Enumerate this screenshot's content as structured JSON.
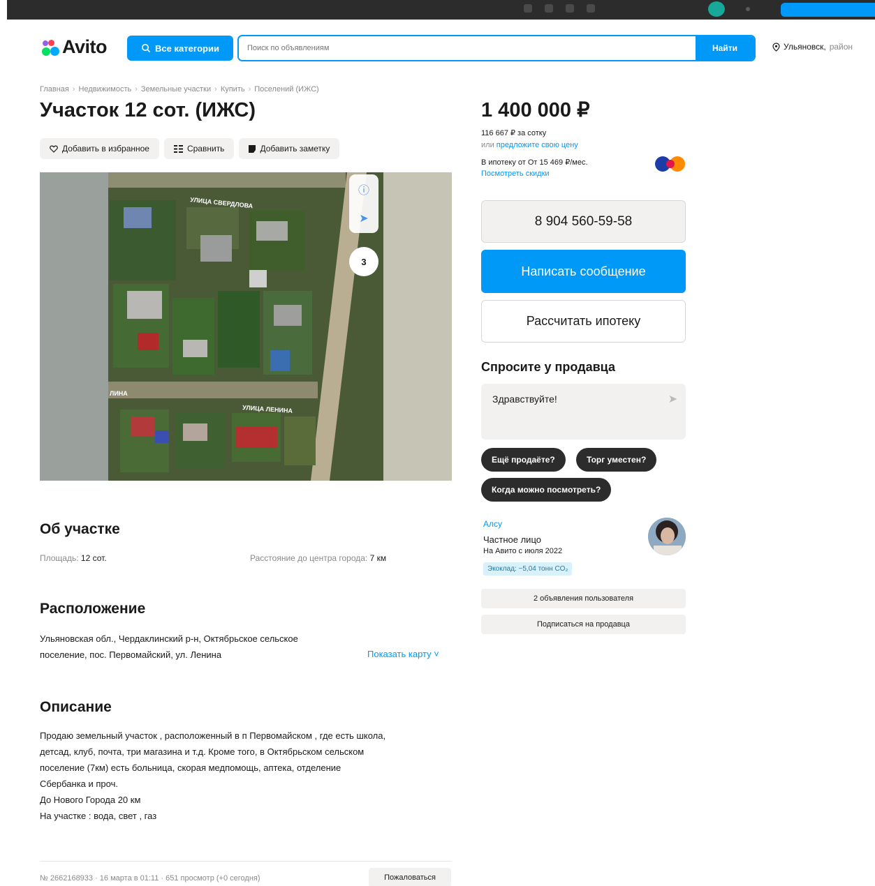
{
  "header": {
    "logo": "Avito",
    "categories_button": "Все категории",
    "search_placeholder": "Поиск по объявлениям",
    "search_button": "Найти",
    "location_city": "Ульяновск,",
    "location_region": "район"
  },
  "breadcrumb": [
    "Главная",
    "Недвижимость",
    "Земельные участки",
    "Купить",
    "Поселений (ИЖС)"
  ],
  "listing": {
    "title": "Участок 12 сот. (ИЖС)",
    "actions": {
      "favorite": "Добавить в избранное",
      "compare": "Сравнить",
      "note": "Добавить заметку"
    },
    "photo": {
      "street_top": "УЛИЦА СВЕРДЛОВА",
      "street_bottom": "УЛИЦА ЛЕНИНА",
      "street_left": "ЛИНА",
      "zoom_level": "3"
    }
  },
  "price": {
    "amount": "1 400 000 ₽",
    "per_unit": "116 667 ₽ за сотку",
    "offer_prefix": "или",
    "offer_link": "предложите свою цену",
    "mortgage": "В ипотеку от От 15 469 ₽/мес.",
    "discounts_link": "Посмотреть скидки"
  },
  "contact": {
    "phone": "8 904 560-59-58",
    "message_button": "Написать сообщение",
    "mortgage_button": "Рассчитать ипотеку"
  },
  "ask": {
    "title": "Спросите у продавца",
    "message": "Здравствуйте!",
    "quick_replies": [
      "Ещё продаёте?",
      "Торг уместен?",
      "Когда можно посмотреть?"
    ]
  },
  "seller": {
    "name": "Алсу",
    "type": "Частное лицо",
    "since": "На Авито с июля 2022",
    "eco": "Экоклад: −5,04 тонн CO₂",
    "listings_button": "2 объявления пользователя",
    "subscribe_button": "Подписаться на продавца"
  },
  "about": {
    "title": "Об участке",
    "area_label": "Площадь:",
    "area_value": "12 сот.",
    "distance_label": "Расстояние до центра города:",
    "distance_value": "7 км"
  },
  "location": {
    "title": "Расположение",
    "address_line1": "Ульяновская обл., Чердаклинский р-н, Октябрьское сельское",
    "address_line2": "поселение, пос. Первомайский, ул. Ленина",
    "show_map": "Показать карту"
  },
  "description": {
    "title": "Описание",
    "lines": [
      "Продаю земельный участок , расположенный в п Первомайском , где есть школа,",
      "детсад, клуб, почта, три магазина и т.д. Кроме того, в Октябрьском сельском",
      "поселение (7км) есть больница, скорая медпомощь, аптека, отделение",
      "Сбербанка и проч.",
      "До Нового Города 20 км",
      "На участке : вода, свет , газ"
    ]
  },
  "footer": {
    "meta": "№ 2662168933 · 16 марта в 01:11 · 651 просмотр (+0 сегодня)",
    "report": "Пожаловаться"
  },
  "colors": {
    "accent": "#0099f7",
    "dark_chip": "#2c2c2c",
    "light_chip": "#f2f1f0"
  }
}
